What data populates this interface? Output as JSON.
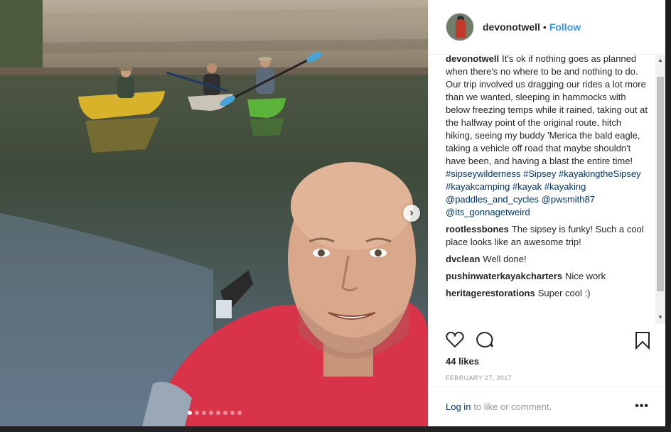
{
  "post": {
    "username": "devonotwell",
    "separator": "•",
    "follow_label": "Follow",
    "slide_count": 8,
    "active_slide": 1
  },
  "caption": {
    "username": "devonotwell",
    "text": "It's ok if nothing goes as planned when there's no where to be and nothing to do. Our trip involved us dragging our rides a lot more than we wanted, sleeping in hammocks with below freezing temps while it rained, taking out at the halfway point of the original route, hitch hiking, seeing my buddy 'Merica the bald eagle, taking a vehicle off road that maybe shouldn't have been, and having a blast the entire time!",
    "tags": [
      "#sipseywilderness",
      "#Sipsey",
      "#kayakingtheSipsey",
      "#kayakcamping",
      "#kayak",
      "#kayaking",
      "@paddles_and_cycles",
      "@pwsmith87",
      "@its_gonnagetweird"
    ]
  },
  "comments": [
    {
      "username": "rootlessbones",
      "text": "The sipsey is funky! Such a cool place looks like an awesome trip!"
    },
    {
      "username": "dvclean",
      "text": "Well done!"
    },
    {
      "username": "pushinwaterkayakcharters",
      "text": "Nice work"
    },
    {
      "username": "heritagerestorations",
      "text": "Super cool :)"
    }
  ],
  "likes": "44 likes",
  "date": "FEBRUARY 27, 2017",
  "footer": {
    "login_label": "Log in",
    "login_rest": "to like or comment.",
    "more_label": "•••"
  },
  "colors": {
    "link": "#003569",
    "follow": "#3897f0",
    "text": "#262626",
    "muted": "#999999"
  },
  "icons": [
    "heart-icon",
    "comment-icon",
    "bookmark-icon",
    "chevron-right-icon"
  ]
}
